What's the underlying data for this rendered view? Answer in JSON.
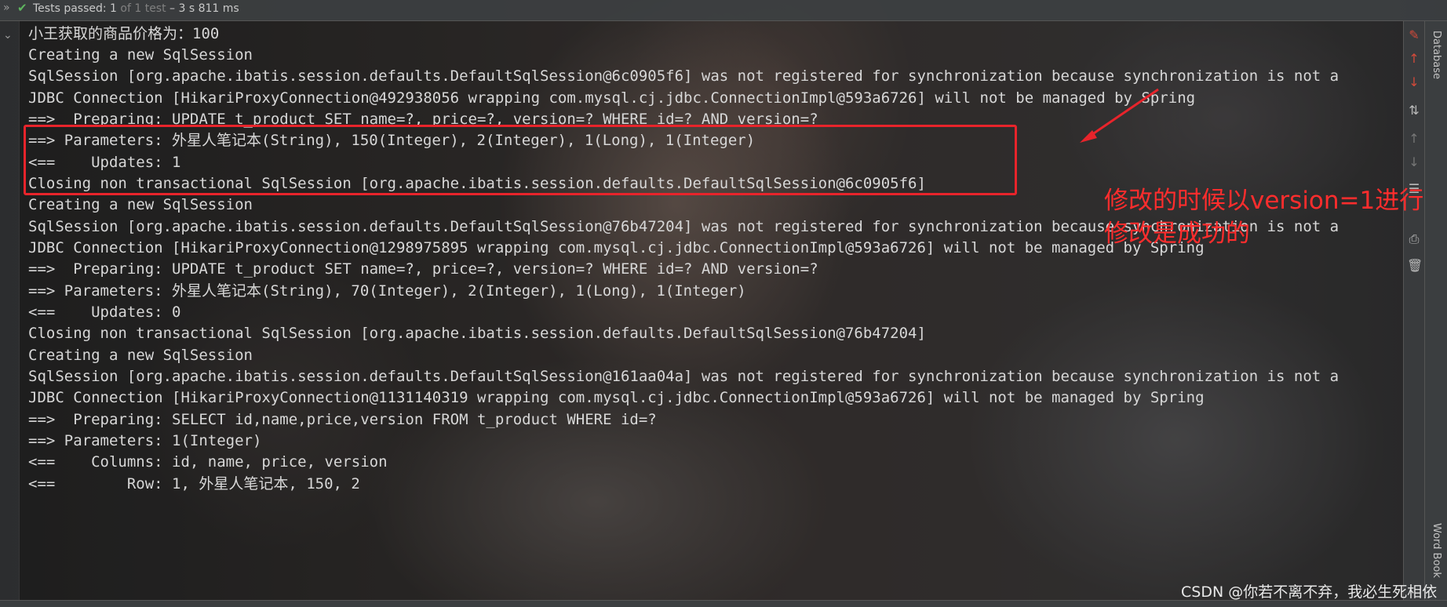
{
  "status_bar": {
    "collapse_icon": "chevron-left-icon",
    "check_icon": "check-icon",
    "tests_prefix": "Tests passed: 1",
    "tests_dim": " of 1 test",
    "tests_time": " – 3 s 811 ms"
  },
  "console": {
    "lines": [
      "小王获取的商品价格为：100",
      "Creating a new SqlSession",
      "SqlSession [org.apache.ibatis.session.defaults.DefaultSqlSession@6c0905f6] was not registered for synchronization because synchronization is not a",
      "JDBC Connection [HikariProxyConnection@492938056 wrapping com.mysql.cj.jdbc.ConnectionImpl@593a6726] will not be managed by Spring",
      "==>  Preparing: UPDATE t_product SET name=?, price=?, version=? WHERE id=? AND version=?",
      "==> Parameters: 外星人笔记本(String), 150(Integer), 2(Integer), 1(Long), 1(Integer)",
      "<==    Updates: 1",
      "Closing non transactional SqlSession [org.apache.ibatis.session.defaults.DefaultSqlSession@6c0905f6]",
      "Creating a new SqlSession",
      "SqlSession [org.apache.ibatis.session.defaults.DefaultSqlSession@76b47204] was not registered for synchronization because synchronization is not a",
      "JDBC Connection [HikariProxyConnection@1298975895 wrapping com.mysql.cj.jdbc.ConnectionImpl@593a6726] will not be managed by Spring",
      "==>  Preparing: UPDATE t_product SET name=?, price=?, version=? WHERE id=? AND version=?",
      "==> Parameters: 外星人笔记本(String), 70(Integer), 2(Integer), 1(Long), 1(Integer)",
      "<==    Updates: 0",
      "Closing non transactional SqlSession [org.apache.ibatis.session.defaults.DefaultSqlSession@76b47204]",
      "Creating a new SqlSession",
      "SqlSession [org.apache.ibatis.session.defaults.DefaultSqlSession@161aa04a] was not registered for synchronization because synchronization is not a",
      "JDBC Connection [HikariProxyConnection@1131140319 wrapping com.mysql.cj.jdbc.ConnectionImpl@593a6726] will not be managed by Spring",
      "==>  Preparing: SELECT id,name,price,version FROM t_product WHERE id=?",
      "==> Parameters: 1(Integer)",
      "<==    Columns: id, name, price, version",
      "<==        Row: 1, 外星人笔记本, 150, 2"
    ]
  },
  "annotation": {
    "note": "修改的时候以version=1进行修改是成功的",
    "color": "#e8242b"
  },
  "right_toolbar": {
    "icons": [
      "clear-all-icon",
      "up-arrow-icon",
      "down-arrow-icon",
      "sort-icon",
      "previous-icon",
      "next-icon",
      "soft-wrap-icon",
      "print-icon",
      "delete-icon"
    ]
  },
  "side_panels": {
    "database": "Database",
    "word_book": "Word Book"
  },
  "watermark": "CSDN @你若不离不弃，我必生死相依"
}
